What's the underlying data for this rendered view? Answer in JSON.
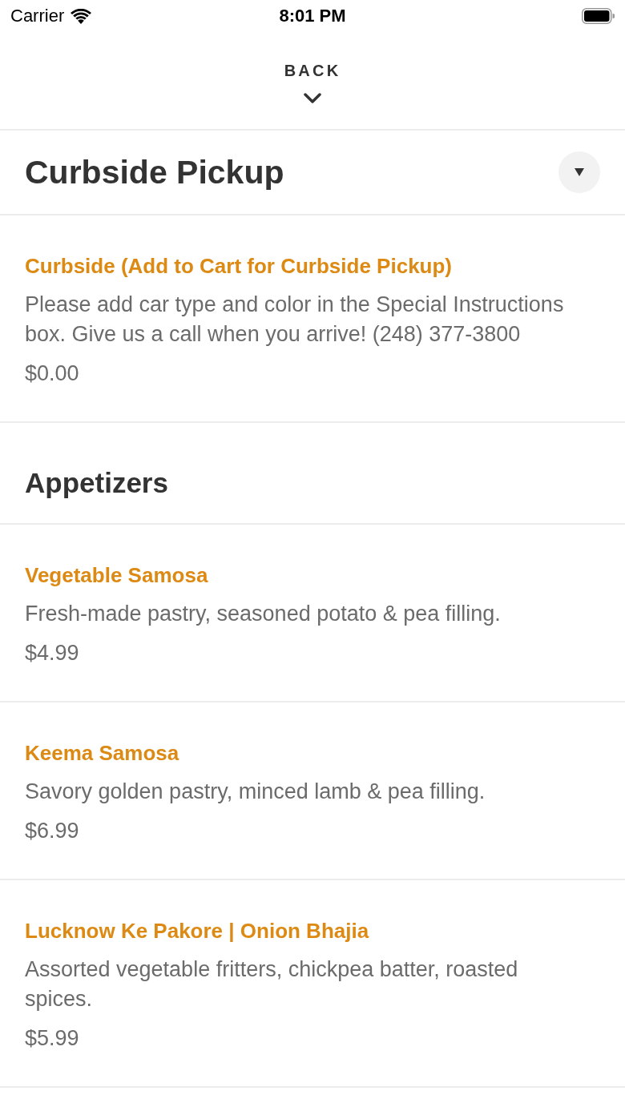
{
  "status_bar": {
    "carrier": "Carrier",
    "time": "8:01 PM"
  },
  "back_button": {
    "label": "BACK"
  },
  "sections": [
    {
      "kind": "collapsible",
      "title": "Curbside Pickup",
      "items": [
        {
          "name": "Curbside (Add to Cart for Curbside Pickup)",
          "description": "Please add car type and color in the Special Instructions box. Give us a call when you arrive! (248) 377-3800",
          "price": "$0.00"
        }
      ]
    },
    {
      "kind": "heading",
      "title": "Appetizers",
      "items": [
        {
          "name": "Vegetable Samosa",
          "description": "Fresh-made pastry, seasoned potato & pea filling.",
          "price": "$4.99"
        },
        {
          "name": "Keema Samosa",
          "description": "Savory golden pastry, minced lamb & pea filling.",
          "price": "$6.99"
        },
        {
          "name": "Lucknow Ke Pakore | Onion Bhajia",
          "description": "Assorted vegetable fritters, chickpea batter, roasted spices.",
          "price": "$5.99"
        }
      ]
    }
  ]
}
